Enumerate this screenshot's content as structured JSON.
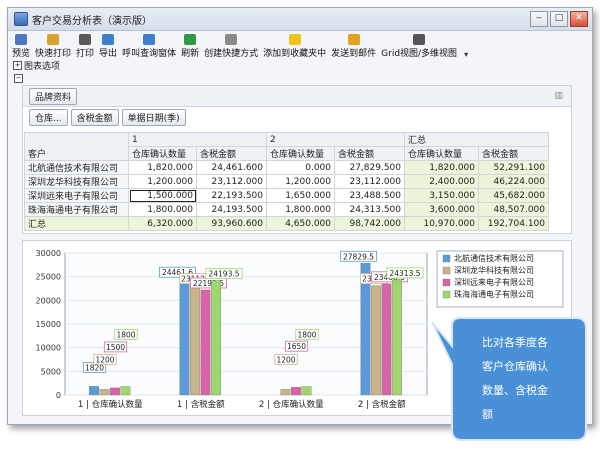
{
  "window": {
    "title": "客户交易分析表（演示版）",
    "min": "‒",
    "max": "□",
    "close": "✕"
  },
  "toolbar": {
    "items": [
      {
        "label": "预览",
        "icon": "preview-icon",
        "color": "#4a78c2"
      },
      {
        "label": "快速打印",
        "icon": "quick-print-icon",
        "color": "#d9a22a"
      },
      {
        "label": "打印",
        "icon": "print-icon",
        "color": "#5a5a5a"
      },
      {
        "label": "导出",
        "icon": "export-icon",
        "color": "#3f7fcf"
      },
      {
        "label": "呼叫查询窗体",
        "icon": "query-window-icon",
        "color": "#3f7fcf"
      },
      {
        "label": "刷新",
        "icon": "refresh-icon",
        "color": "#2f9a43"
      },
      {
        "label": "创建快捷方式",
        "icon": "shortcut-icon",
        "color": "#8a8a8a"
      },
      {
        "label": "添加到收藏夹中",
        "icon": "favorite-star-icon",
        "color": "#f0c21c"
      },
      {
        "label": "发送到邮件",
        "icon": "mail-icon",
        "color": "#e3a21e"
      },
      {
        "label": "Grid视图/多维视图",
        "icon": "grid-view-icon",
        "color": "#555555"
      }
    ],
    "more": "▾"
  },
  "options_label": "图表选项",
  "pivot": {
    "filter_chip": "品牌资料",
    "field_chips": [
      "仓库...",
      "含税金额",
      "单据日期(季)"
    ],
    "customer_header": "客户",
    "period_headers": [
      "1",
      "2",
      "汇总"
    ],
    "measure_headers": [
      "仓库确认数量",
      "含税金额"
    ],
    "rows": [
      {
        "name": "北航通信技术有限公司",
        "values": [
          "1,820.000",
          "24,461.600",
          "0.000",
          "27,829.500",
          "1,820.000",
          "52,291.100"
        ]
      },
      {
        "name": "深圳龙华科技有限公司",
        "values": [
          "1,200.000",
          "23,112.000",
          "1,200.000",
          "23,112.000",
          "2,400.000",
          "46,224.000"
        ]
      },
      {
        "name": "深圳远来电子有限公司",
        "values": [
          "1,500.000",
          "22,193.500",
          "1,650.000",
          "23,488.500",
          "3,150.000",
          "45,682.000"
        ]
      },
      {
        "name": "珠海海通电子有限公司",
        "values": [
          "1,800.000",
          "24,193.500",
          "1,800.000",
          "24,313.500",
          "3,600.000",
          "48,507.000"
        ]
      }
    ],
    "total": {
      "name": "汇总",
      "values": [
        "6,320.000",
        "93,960.600",
        "4,650.000",
        "98,742.000",
        "10,970.000",
        "192,704.100"
      ]
    }
  },
  "chart_data": {
    "type": "bar",
    "categories": [
      "1 | 仓库确认数量",
      "1 | 含税金额",
      "2 | 仓库确认数量",
      "2 | 含税金额"
    ],
    "series": [
      {
        "name": "北航通信技术有限公司",
        "color": "#5b9bd5",
        "values": [
          1820,
          24461.6,
          0,
          27829.5
        ],
        "labels": [
          "1820",
          "24461.6",
          "",
          "27829.5"
        ]
      },
      {
        "name": "深圳龙华科技有限公司",
        "color": "#c9b48a",
        "values": [
          1200,
          23112,
          1200,
          23112
        ],
        "labels": [
          "1200",
          "23112",
          "1200",
          "23112"
        ]
      },
      {
        "name": "深圳远来电子有限公司",
        "color": "#d664a6",
        "values": [
          1500,
          22193.5,
          1650,
          23488.5
        ],
        "labels": [
          "1500",
          "22193.5",
          "1650",
          "23488.5"
        ]
      },
      {
        "name": "珠海海通电子有限公司",
        "color": "#9fd66e",
        "values": [
          1800,
          24193.5,
          1800,
          24313.5
        ],
        "labels": [
          "1800",
          "24193.5",
          "1800",
          "24313.5"
        ]
      }
    ],
    "yticks": [
      "0",
      "5000",
      "10000",
      "15000",
      "20000",
      "25000",
      "30000"
    ],
    "ylim": [
      0,
      30000
    ],
    "legend_position": "right"
  },
  "callout": {
    "line1": "比对各季度各",
    "line2": "客户仓库确认",
    "line3": "数量、含税金",
    "line4": "额",
    "color": "#4a90d6"
  }
}
